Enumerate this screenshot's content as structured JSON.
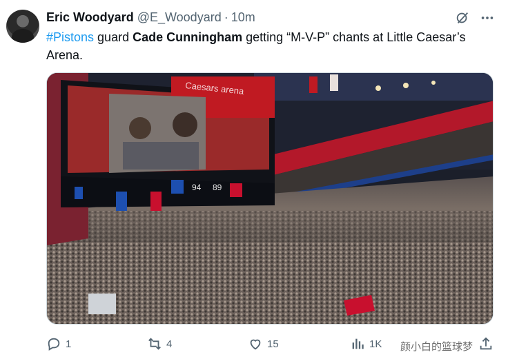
{
  "tweet": {
    "author_name": "Eric Woodyard",
    "author_handle": "@E_Woodyard",
    "separator": "·",
    "time": "10m",
    "text_hashtag": "#Pistons",
    "text_1": " guard ",
    "text_bold": "Cade Cunningham",
    "text_2": " getting “M-V-P” chants at Little Caesar’s Arena."
  },
  "media": {
    "scoreboard_score_left": "94",
    "scoreboard_score_right": "89",
    "arena_banner": "Caesars arena"
  },
  "actions": {
    "reply_count": "1",
    "retweet_count": "4",
    "like_count": "15",
    "views_count": "1K"
  },
  "icons": [
    "grok-icon",
    "more-icon",
    "reply-icon",
    "retweet-icon",
    "like-icon",
    "views-icon",
    "share-icon"
  ],
  "colors": {
    "link": "#1d9bf0",
    "muted": "#536471",
    "text": "#0f1419",
    "pistons_red": "#c8102e"
  },
  "watermark": "颜小白的篮球梦"
}
